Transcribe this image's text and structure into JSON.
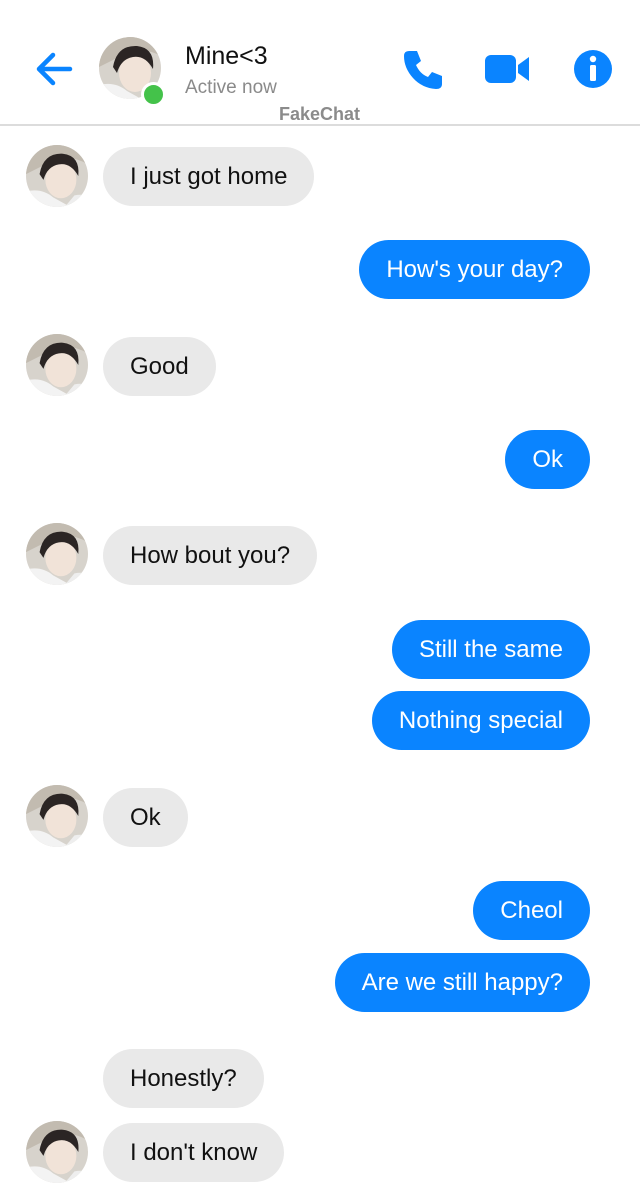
{
  "header": {
    "contact_name": "Mine<3",
    "status": "Active now",
    "watermark": "FakeChat",
    "online_color": "#44c24a",
    "accent_color": "#0a84ff",
    "icons": [
      "arrow-left-icon",
      "phone-icon",
      "video-camera-icon",
      "info-icon"
    ]
  },
  "messages": [
    {
      "side": "received",
      "text": "I just got home"
    },
    {
      "side": "sent",
      "text": "How's your day?"
    },
    {
      "side": "received",
      "text": "Good"
    },
    {
      "side": "sent",
      "text": "Ok"
    },
    {
      "side": "received",
      "text": "How bout you?"
    },
    {
      "side": "sent",
      "text": "Still the same"
    },
    {
      "side": "sent",
      "text": "Nothing special"
    },
    {
      "side": "received",
      "text": "Ok"
    },
    {
      "side": "sent",
      "text": "Cheol"
    },
    {
      "side": "sent",
      "text": "Are we still happy?"
    },
    {
      "side": "received",
      "text": "Honestly?"
    },
    {
      "side": "received",
      "text": "I don't know"
    }
  ]
}
